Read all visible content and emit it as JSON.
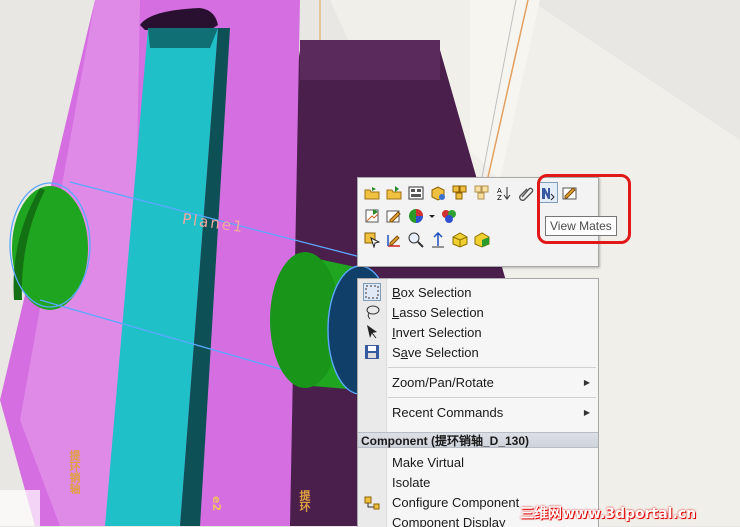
{
  "colors": {
    "magenta_face": "#d56ee0",
    "cyan_face": "#20c0c8",
    "dark_body": "#4a1f4c",
    "green_face": "#1fa51f",
    "highlight_edge": "#5aa8ff",
    "callout_red": "#e01818"
  },
  "viewport": {
    "plane_label": "Plane1",
    "side_text_left": "提环销轴",
    "side_text_mid": "e2",
    "side_text_right": "提环"
  },
  "toolbar": {
    "row1_icons": [
      "open-part-icon",
      "open-assembly-icon",
      "isometric-view-icon",
      "component-properties-icon",
      "hide-show-icon",
      "change-transparency-icon",
      "sort-icon",
      "attach-icon",
      "view-mates-icon",
      "edit-feature-icon"
    ],
    "row2_icons": [
      "open-drawing-icon",
      "edit-sketch-icon",
      "appearance-icon",
      "appearance-dropdown-icon",
      "colors-icon"
    ],
    "row3_icons": [
      "select-other-icon",
      "sketch-icon",
      "zoom-to-selection-icon",
      "normal-to-icon",
      "make-virtual-icon",
      "hide-component-icon"
    ],
    "tooltip": "View Mates"
  },
  "menu": {
    "selection_items": [
      {
        "label": "Box Selection",
        "accel": "B",
        "icon": "box-selection-icon"
      },
      {
        "label": "Lasso Selection",
        "accel": "L",
        "icon": "lasso-selection-icon"
      },
      {
        "label": "Invert Selection",
        "accel": "I",
        "icon": "invert-selection-icon"
      },
      {
        "label": "Save Selection",
        "accel": "a",
        "icon": "save-selection-icon"
      }
    ],
    "zoom_pan_rotate": "Zoom/Pan/Rotate",
    "recent_commands": "Recent Commands",
    "component_header": "Component (提环销轴_D_130)",
    "component_items": [
      {
        "label": "Make Virtual",
        "icon": ""
      },
      {
        "label": "Isolate",
        "icon": ""
      },
      {
        "label": "Configure Component",
        "icon": "configure-component-icon"
      },
      {
        "label": "Component Display",
        "icon": ""
      }
    ]
  },
  "watermark": "三维网www.3dportal.cn"
}
